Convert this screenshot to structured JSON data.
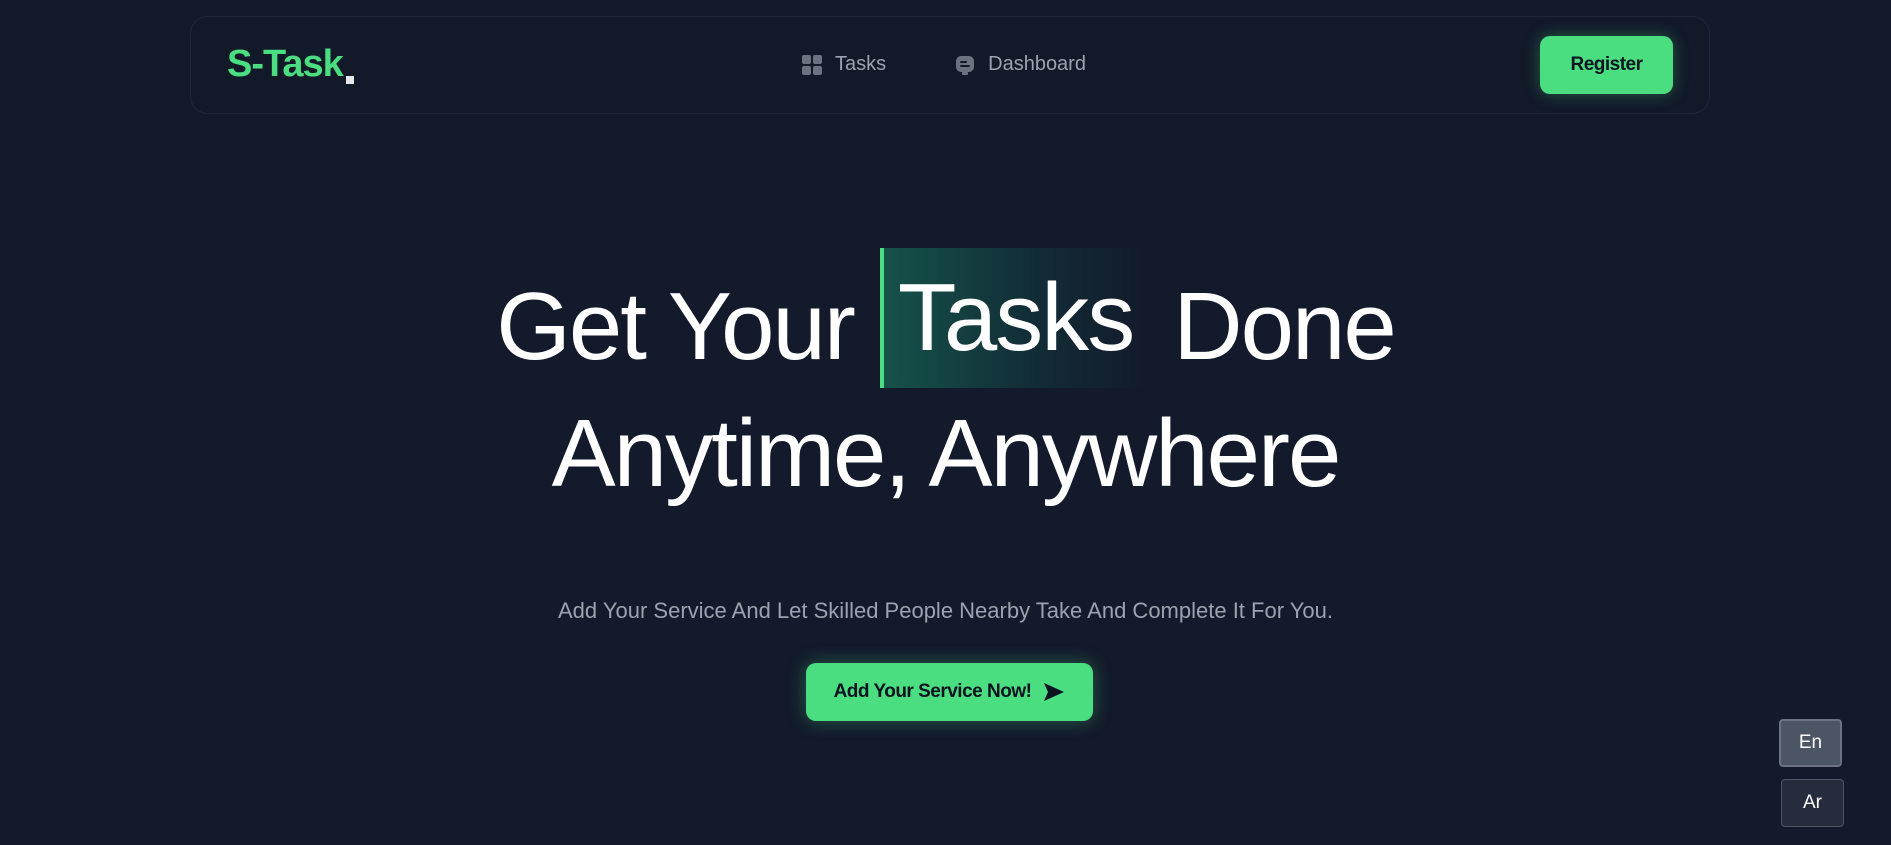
{
  "brand": {
    "name": "S-Task",
    "accent_color": "#4ade80",
    "background_color": "#131a2b"
  },
  "nav": {
    "items": [
      {
        "label": "Tasks",
        "icon": "grid-icon"
      },
      {
        "label": "Dashboard",
        "icon": "dashboard-icon"
      }
    ],
    "register_label": "Register"
  },
  "hero": {
    "line1_before": "Get Your",
    "highlight": "Tasks",
    "line1_after": "Done",
    "line2": "Anytime, Anywhere",
    "subtitle": "Add Your Service And Let Skilled People Nearby Take And Complete It For You.",
    "cta_label": "Add Your Service Now!",
    "cta_icon": "send-arrow-icon"
  },
  "language": {
    "options": [
      "En",
      "Ar"
    ],
    "selected": "En"
  }
}
